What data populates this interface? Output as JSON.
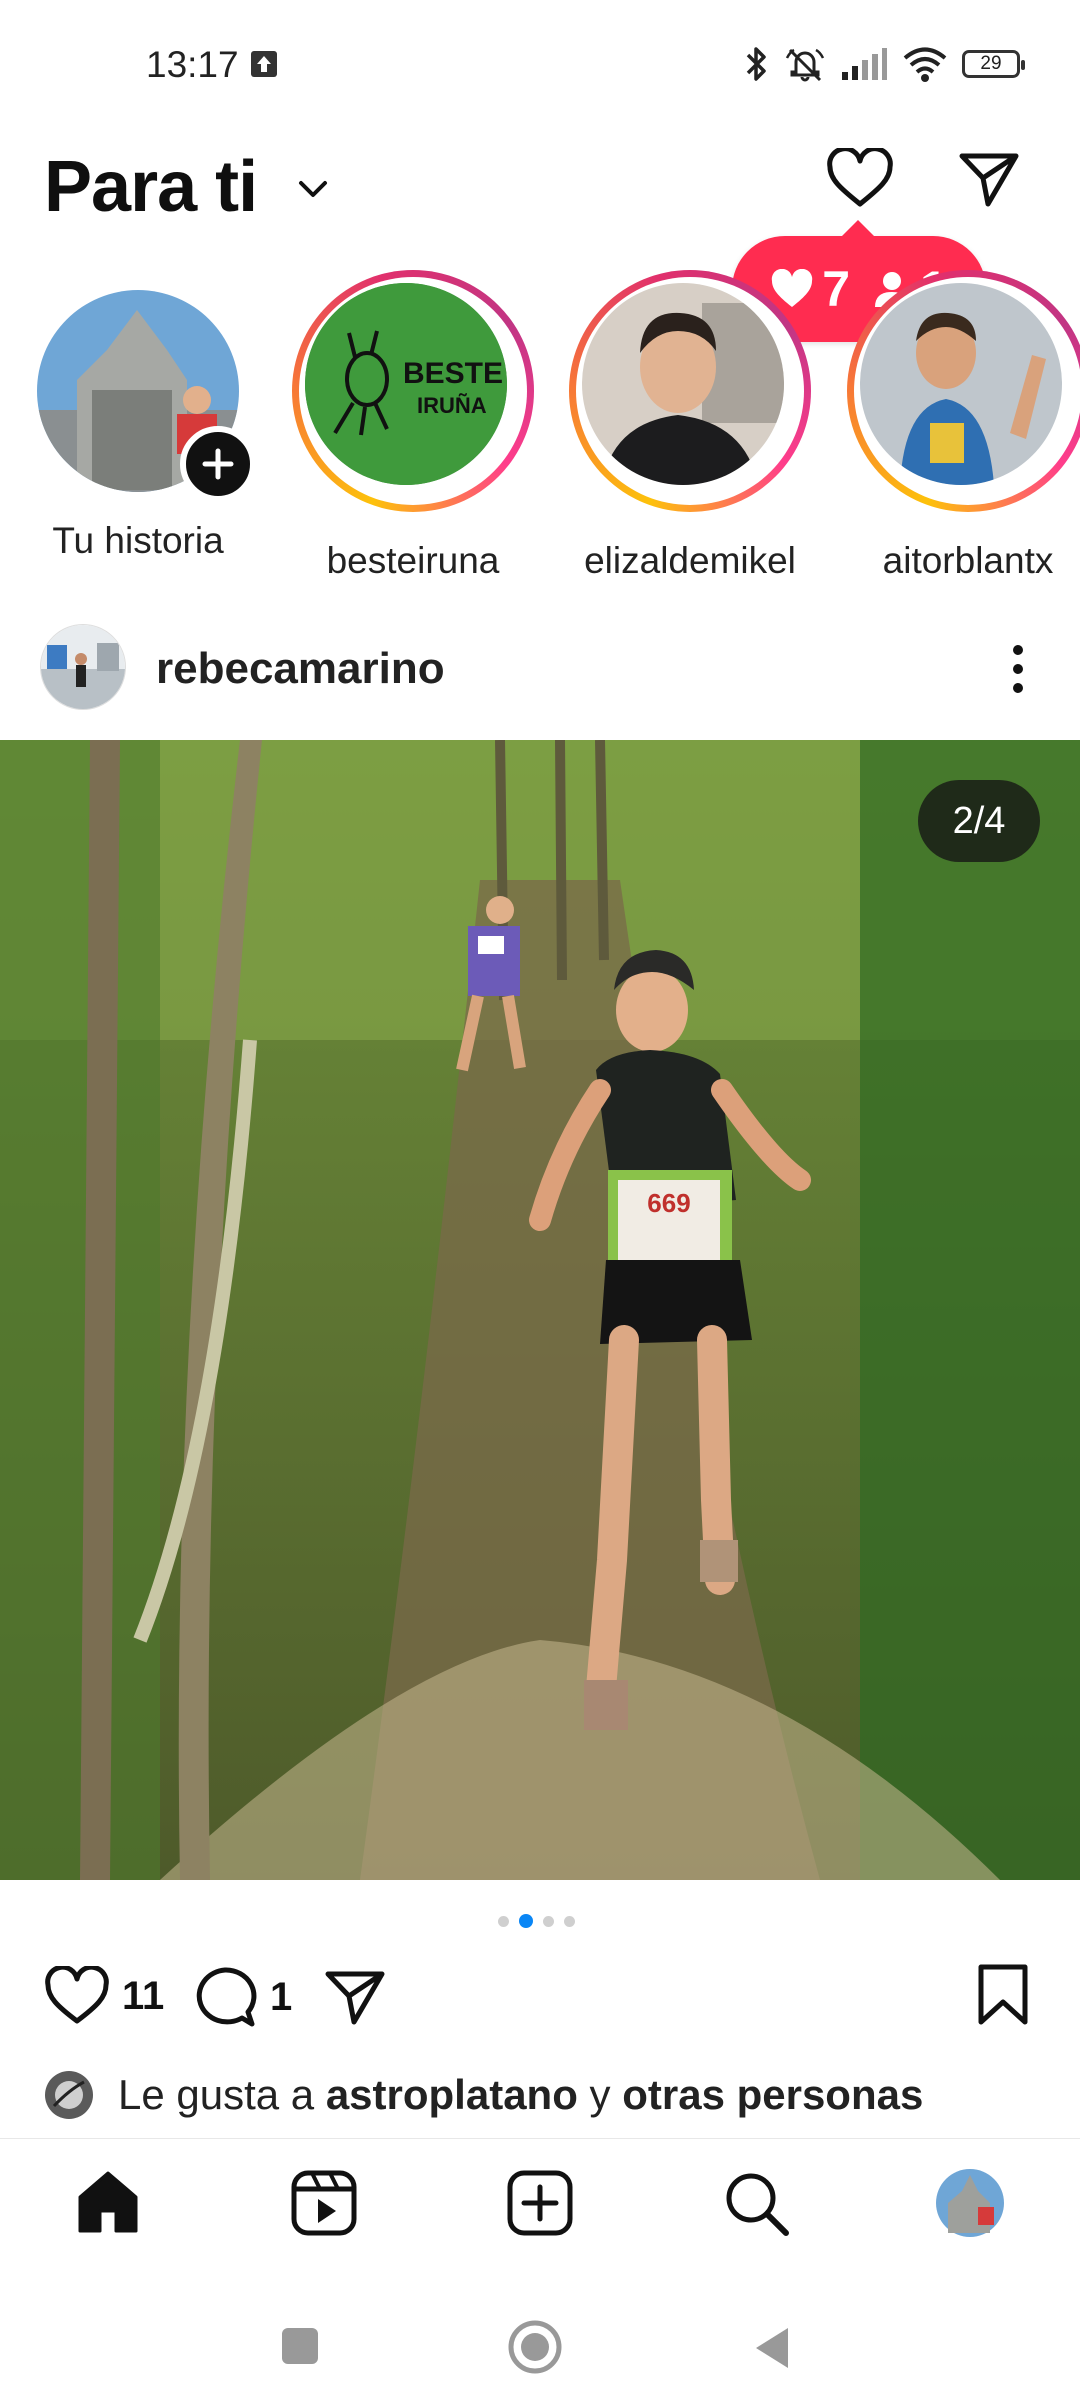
{
  "status_bar": {
    "time": "13:17",
    "battery": "29"
  },
  "header": {
    "title": "Para ti"
  },
  "notification": {
    "likes": "7",
    "followers": "1"
  },
  "stories": [
    {
      "label": "Tu historia"
    },
    {
      "label": "besteiruna",
      "logo_line1": "BESTE",
      "logo_line2": "IRUÑA"
    },
    {
      "label": "elizaldemikel"
    },
    {
      "label": "aitorblantx"
    }
  ],
  "post": {
    "username": "rebecamarino",
    "counter": "2/4",
    "bib_number": "669",
    "likes_count": "11",
    "comments_count": "1",
    "liked_by_prefix": "Le gusta a ",
    "liked_by_user": "astroplatano",
    "liked_by_middle": " y ",
    "liked_by_others": "otras personas"
  },
  "colors": {
    "accent": "#0a86f5",
    "notification": "#ff2c50"
  },
  "icons": [
    "upload-icon",
    "bluetooth-icon",
    "muted-bell-icon",
    "signal-icon",
    "wifi-icon",
    "battery-icon",
    "chevron-down-icon",
    "heart-icon",
    "send-icon",
    "plus-icon",
    "more-icon",
    "comment-icon",
    "bookmark-icon",
    "home-icon",
    "reels-icon",
    "create-icon",
    "search-icon",
    "profile-avatar",
    "recents-icon",
    "home-circle-icon",
    "back-icon"
  ]
}
